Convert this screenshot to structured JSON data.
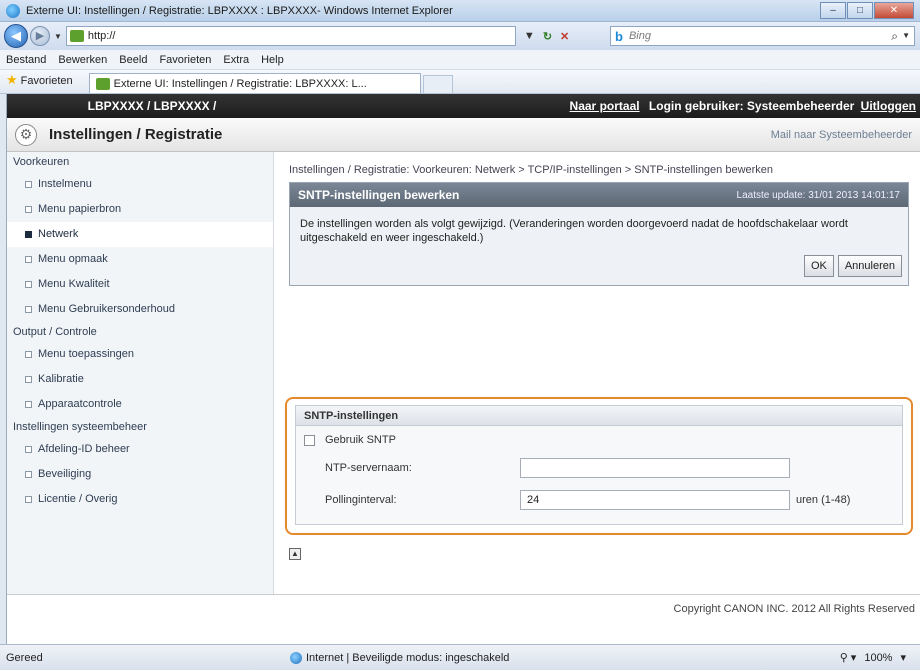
{
  "window": {
    "title": "Externe UI: Instellingen / Registratie: LBPXXXX : LBPXXXX- Windows Internet Explorer",
    "url": "http://",
    "search_placeholder": "Bing"
  },
  "menubar": [
    "Bestand",
    "Bewerken",
    "Beeld",
    "Favorieten",
    "Extra",
    "Help"
  ],
  "favorites": {
    "label": "Favorieten",
    "tab_title": "Externe UI: Instellingen / Registratie: LBPXXXX: L..."
  },
  "topbar": {
    "device": "LBPXXXX / LBPXXXX /",
    "portal": "Naar portaal",
    "login": "Login gebruiker: Systeembeheerder",
    "logout": "Uitloggen"
  },
  "header": {
    "title": "Instellingen / Registratie",
    "mail_link": "Mail naar Systeembeheerder"
  },
  "sidebar": {
    "groups": [
      {
        "label": "Voorkeuren",
        "items": [
          "Instelmenu",
          "Menu papierbron",
          "Netwerk",
          "Menu opmaak",
          "Menu Kwaliteit",
          "Menu Gebruikersonderhoud"
        ]
      },
      {
        "label": "Output / Controle",
        "items": [
          "Menu toepassingen",
          "Kalibratie",
          "Apparaatcontrole"
        ]
      },
      {
        "label": "Instellingen systeembeheer",
        "items": [
          "Afdeling-ID beheer",
          "Beveiliging",
          "Licentie / Overig"
        ]
      }
    ],
    "active": "Netwerk"
  },
  "main": {
    "breadcrumb": "Instellingen / Registratie: Voorkeuren: Netwerk > TCP/IP-instellingen > SNTP-instellingen bewerken",
    "panel": {
      "title": "SNTP-instellingen bewerken",
      "last_update": "Laatste update: 31/01 2013 14:01:17",
      "message": "De instellingen worden als volgt gewijzigd. (Veranderingen worden doorgevoerd nadat de hoofdschakelaar wordt uitgeschakeld en weer ingeschakeld.)",
      "ok_label": "OK",
      "cancel_label": "Annuleren"
    },
    "sntp": {
      "section_title": "SNTP-instellingen",
      "use_sntp_label": "Gebruik SNTP",
      "use_sntp_checked": false,
      "ntp_server_label": "NTP-servernaam:",
      "ntp_server_value": "",
      "polling_label": "Pollinginterval:",
      "polling_value": "24",
      "polling_unit": "uren (1-48)"
    }
  },
  "footer": {
    "copyright": "Copyright CANON INC. 2012 All Rights Reserved"
  },
  "statusbar": {
    "ready": "Gereed",
    "zone": "Internet | Beveiligde modus: ingeschakeld",
    "zoom": "100%"
  }
}
